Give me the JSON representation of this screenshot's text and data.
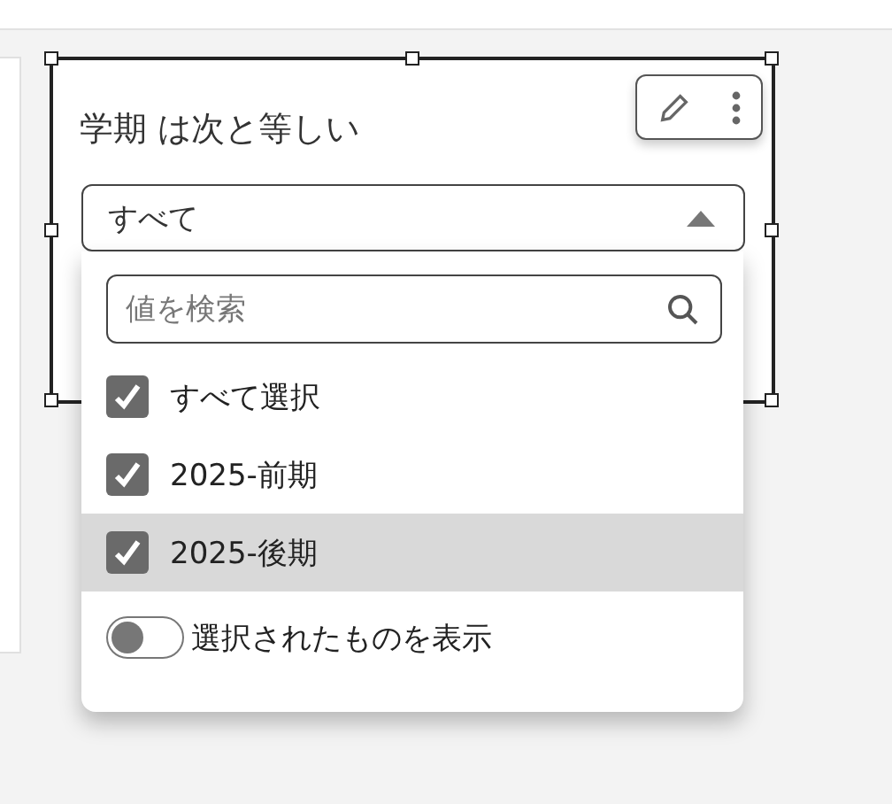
{
  "control": {
    "title": "学期 は次と等しい",
    "selected_frame": true,
    "dropdown": {
      "value": "すべて",
      "expanded": true
    },
    "popover": {
      "search": {
        "placeholder": "値を検索"
      },
      "options": [
        {
          "label": "すべて選択",
          "checked": true,
          "highlighted": false
        },
        {
          "label": "2025-前期",
          "checked": true,
          "highlighted": false
        },
        {
          "label": "2025-後期",
          "checked": true,
          "highlighted": true
        }
      ],
      "toggle": {
        "label": "選択されたものを表示",
        "on": false
      }
    }
  }
}
